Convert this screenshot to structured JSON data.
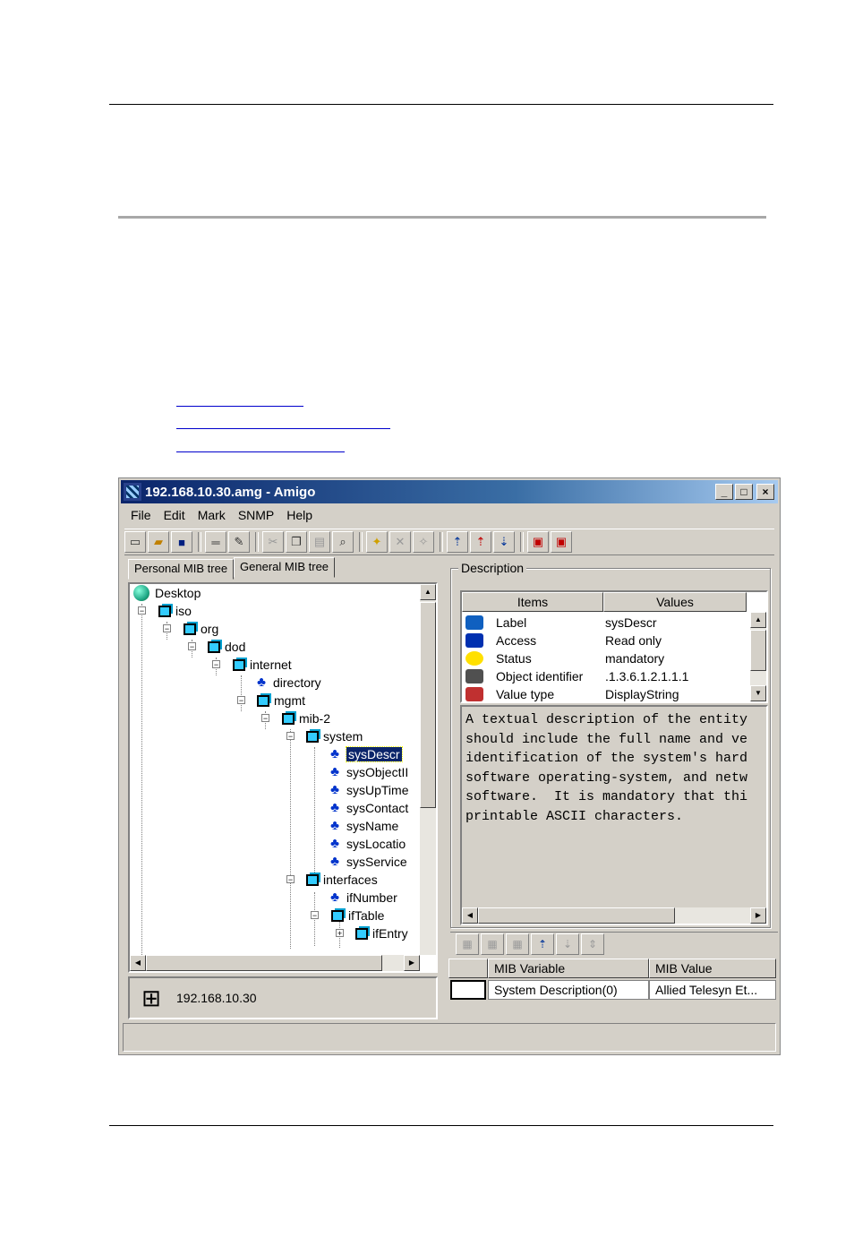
{
  "window": {
    "title": "192.168.10.30.amg - Amigo",
    "controls": [
      "_",
      "□",
      "×"
    ]
  },
  "menu": [
    "File",
    "Edit",
    "Mark",
    "SNMP",
    "Help"
  ],
  "tabs": [
    "Personal MIB tree",
    "General MIB tree"
  ],
  "tree": {
    "desktop": "Desktop",
    "iso": "iso",
    "org": "org",
    "dod": "dod",
    "internet": "internet",
    "directory": "directory",
    "mgmt": "mgmt",
    "mib2": "mib-2",
    "system": "system",
    "system_children": [
      "sysDescr",
      "sysObjectII",
      "sysUpTime",
      "sysContact",
      "sysName",
      "sysLocatio",
      "sysService"
    ],
    "interfaces": "interfaces",
    "ifNumber": "ifNumber",
    "ifTable": "ifTable",
    "ifEntry": "ifEntry"
  },
  "agent": {
    "ip": "192.168.10.30"
  },
  "description": {
    "legend": "Description",
    "headers": {
      "items": "Items",
      "values": "Values"
    },
    "rows": [
      {
        "item": "Label",
        "value": "sysDescr",
        "icon": "label-icon",
        "color": "#1060c0"
      },
      {
        "item": "Access",
        "value": "Read only",
        "icon": "access-icon",
        "color": "#0030b0"
      },
      {
        "item": "Status",
        "value": "mandatory",
        "icon": "bulb-icon",
        "color": "#ffe000"
      },
      {
        "item": "Object identifier",
        "value": ".1.3.6.1.2.1.1.1",
        "icon": "oid-icon",
        "color": "#505050"
      },
      {
        "item": "Value type",
        "value": "DisplayString",
        "icon": "type-icon",
        "color": "#c03030"
      }
    ],
    "text": "A textual description of the entity\nshould include the full name and ve\nidentification of the system's hard\nsoftware operating-system, and netw\nsoftware.  It is mandatory that thi\nprintable ASCII characters."
  },
  "variables": {
    "headers": {
      "variable": "MIB Variable",
      "value": "MIB Value"
    },
    "rows": [
      {
        "variable": "System Description(0)",
        "value": "Allied Telesyn Et..."
      }
    ]
  },
  "colors": {
    "titlebar": "#0a246a",
    "selection": "#0a246a",
    "chrome": "#d4d0c8"
  }
}
